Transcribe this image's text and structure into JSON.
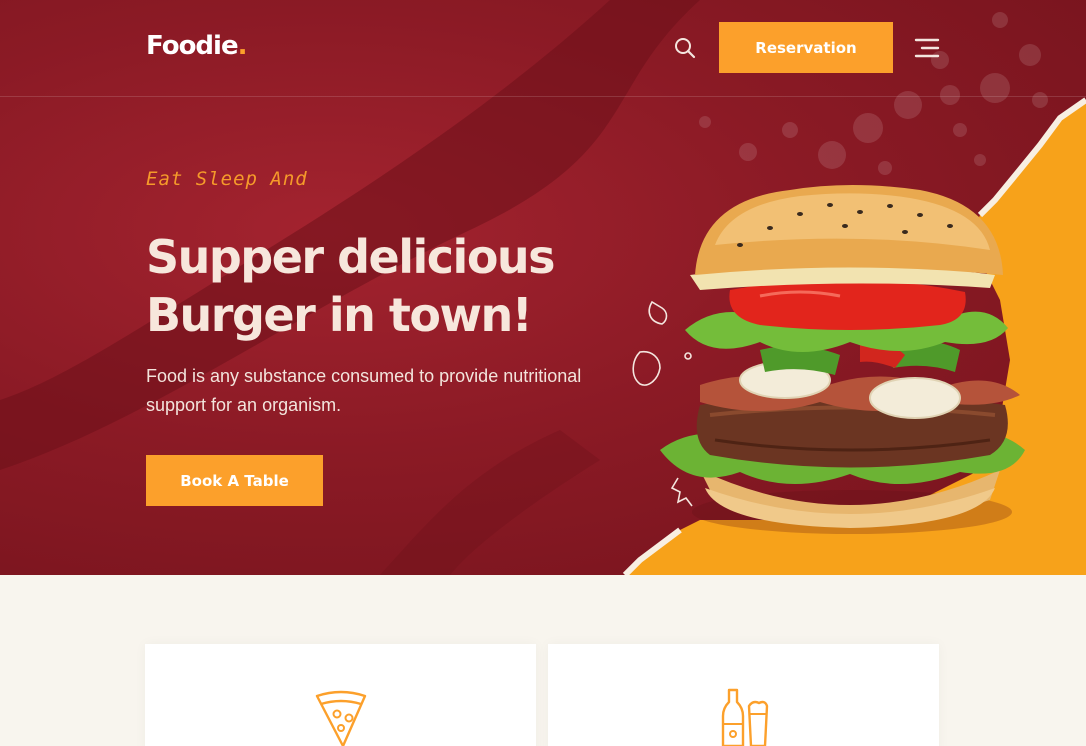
{
  "header": {
    "logo_text": "Foodie",
    "logo_dot": ".",
    "search_icon": "search-icon",
    "reservation_label": "Reservation",
    "menu_icon": "hamburger-menu-icon"
  },
  "hero": {
    "tagline": "Eat Sleep And",
    "headline_line1": "Supper delicious",
    "headline_line2": "Burger in town!",
    "description": "Food is any substance consumed to provide nutritional support for an organism.",
    "cta_label": "Book A Table",
    "image": "burger-image"
  },
  "features": {
    "cards": [
      {
        "icon": "pizza-icon"
      },
      {
        "icon": "drinks-icon"
      }
    ]
  },
  "colors": {
    "hero_red": "#8b1a25",
    "accent_orange": "#fca02b",
    "yellow_panel": "#f7a21a",
    "page_bg": "#f8f5ee"
  }
}
